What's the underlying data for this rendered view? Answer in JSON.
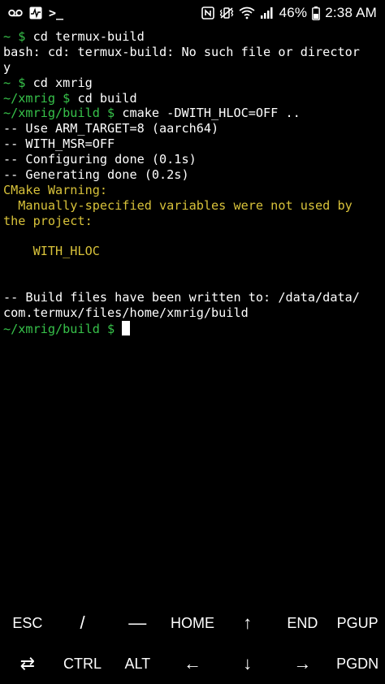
{
  "status_bar": {
    "icons_left": [
      "voicemail-icon",
      "activity-icon",
      "terminal-icon"
    ],
    "terminal_symbol": ">_",
    "icons_right": [
      "nfc-icon",
      "vibrate-icon",
      "wifi-icon",
      "signal-icon",
      "battery-icon"
    ],
    "battery_percent": "46%",
    "time": "2:38 AM"
  },
  "terminal": {
    "lines": [
      {
        "prompt": "~ $ ",
        "text": "cd termux-build"
      },
      {
        "text": "bash: cd: termux-build: No such file or director"
      },
      {
        "text": "y"
      },
      {
        "prompt": "~ $ ",
        "text": "cd xmrig"
      },
      {
        "prompt": "~/xmrig $ ",
        "text": "cd build"
      },
      {
        "prompt": "~/xmrig/build $ ",
        "text": "cmake -DWITH_HLOC=OFF .."
      },
      {
        "text": "-- Use ARM_TARGET=8 (aarch64)"
      },
      {
        "text": "-- WITH_MSR=OFF"
      },
      {
        "text": "-- Configuring done (0.1s)"
      },
      {
        "text": "-- Generating done (0.2s)"
      },
      {
        "warn": "CMake Warning:"
      },
      {
        "warn": "  Manually-specified variables were not used by"
      },
      {
        "warn": "the project:"
      },
      {
        "text": ""
      },
      {
        "warn": "    WITH_HLOC"
      },
      {
        "text": ""
      },
      {
        "text": ""
      },
      {
        "text": "-- Build files have been written to: /data/data/"
      },
      {
        "text": "com.termux/files/home/xmrig/build"
      },
      {
        "prompt": "~/xmrig/build $ ",
        "text": ""
      }
    ]
  },
  "extra_keys": {
    "row1": [
      "ESC",
      "/",
      "—",
      "HOME",
      "↑",
      "END",
      "PGUP"
    ],
    "row2": [
      "⇄",
      "CTRL",
      "ALT",
      "←",
      "↓",
      "→",
      "PGDN"
    ]
  },
  "colors": {
    "prompt": "#37c24a",
    "warning": "#d8c23a",
    "background": "#000000",
    "text": "#ffffff"
  }
}
